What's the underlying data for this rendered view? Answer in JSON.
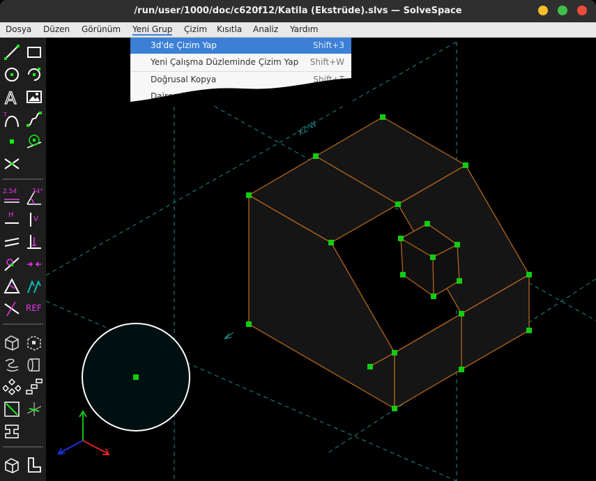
{
  "window": {
    "title": "/run/user/1000/doc/c620f12/Katila (Ekstrüde).slvs — SolveSpace"
  },
  "menu": [
    "Dosya",
    "Düzen",
    "Görünüm",
    "Yeni Grup",
    "Çizim",
    "Kısıtla",
    "Analiz",
    "Yardım"
  ],
  "dropdown": {
    "items": [
      {
        "label": "3d'de Çizim Yap",
        "shortcut": "Shift+3"
      },
      {
        "label": "Yeni Çalışma Düzleminde Çizim Yap",
        "shortcut": "Shift+W"
      },
      {
        "label": "Doğrusal Kopya",
        "shortcut": "Shift+T"
      },
      {
        "label": "Dairesel Kopya",
        "shortcut": ""
      }
    ]
  },
  "toolbar": {
    "dimension_label": "2.54",
    "angle_label": "74°",
    "horizontal_label": "H",
    "vertical_label": "V",
    "ref_label": "REF"
  },
  "canvas": {
    "axis_label": "XZ-W",
    "colors": {
      "edge": "#b5651d",
      "point": "#11cc11",
      "guide": "#1f8a8a",
      "face": "#161616"
    }
  }
}
